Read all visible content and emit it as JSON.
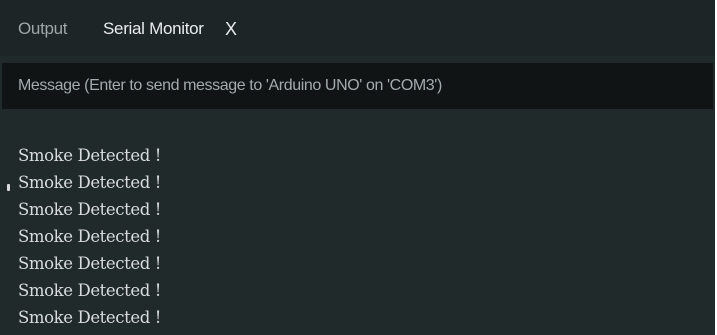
{
  "tabs": {
    "output_label": "Output",
    "serial_monitor_label": "Serial Monitor",
    "close_glyph": "X"
  },
  "message_input": {
    "placeholder": "Message (Enter to send message to 'Arduino UNO' on 'COM3')",
    "value": ""
  },
  "serial_output": {
    "lines": [
      "Smoke Detected !",
      "Smoke Detected !",
      "Smoke Detected !",
      "Smoke Detected !",
      "Smoke Detected !",
      "Smoke Detected !",
      "Smoke Detected !"
    ]
  },
  "colors": {
    "panel_background": "#212a2b",
    "tabbar_background": "#1e2527",
    "input_background": "#101415",
    "active_tab_text": "#e8ecec",
    "inactive_tab_text": "#9ea6a8",
    "output_text": "#d8dcdc"
  }
}
